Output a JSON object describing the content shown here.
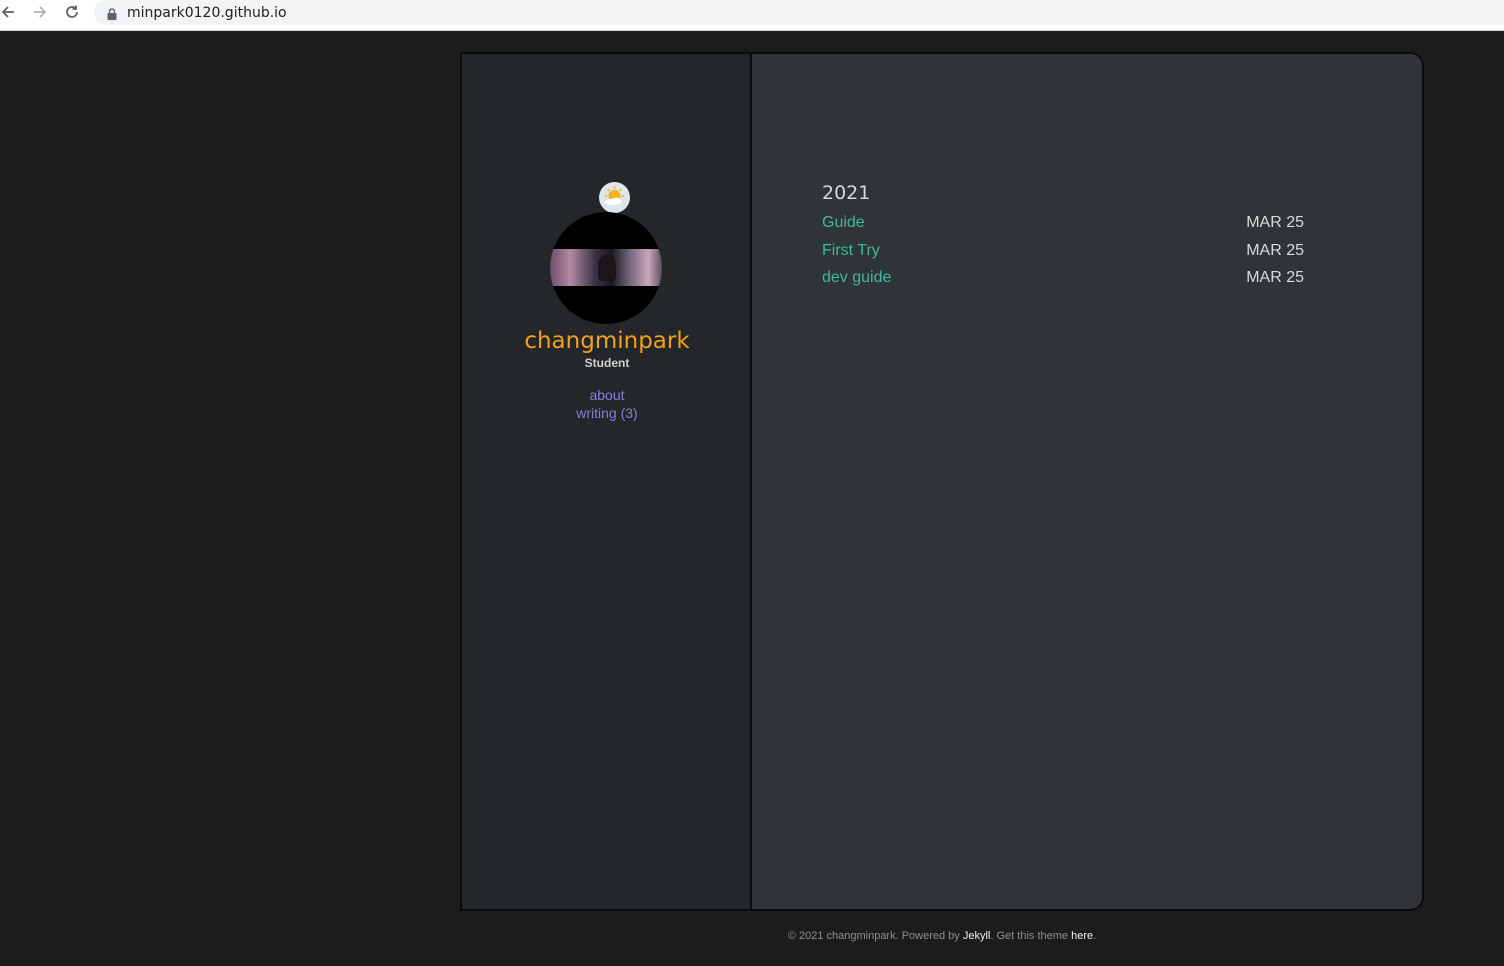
{
  "browser": {
    "url": "minpark0120.github.io",
    "icons": [
      "back-arrow-icon",
      "forward-arrow-icon",
      "reload-icon",
      "lock-icon"
    ]
  },
  "sidebar": {
    "weather_icon": "sun-cloud-icon",
    "name": "changminpark",
    "role": "Student",
    "links": [
      {
        "label": "about"
      },
      {
        "label": "writing (3)"
      }
    ]
  },
  "content": {
    "year": "2021",
    "posts": [
      {
        "title": "Guide",
        "date": "MAR 25"
      },
      {
        "title": "First Try",
        "date": "MAR 25"
      },
      {
        "title": "dev guide",
        "date": "MAR 25"
      }
    ]
  },
  "footer": {
    "prefix": "© 2021 changminpark. Powered by ",
    "jekyll": "Jekyll",
    "middle": ". Get this theme ",
    "here": "here",
    "suffix": "."
  },
  "colors": {
    "page_bg": "#1c1c1e",
    "sidebar_bg": "#23272a",
    "content_bg": "#2f3437",
    "name_accent": "#f59e1b",
    "link_purple": "#8c7ad8",
    "post_link": "#3fb8a0"
  }
}
